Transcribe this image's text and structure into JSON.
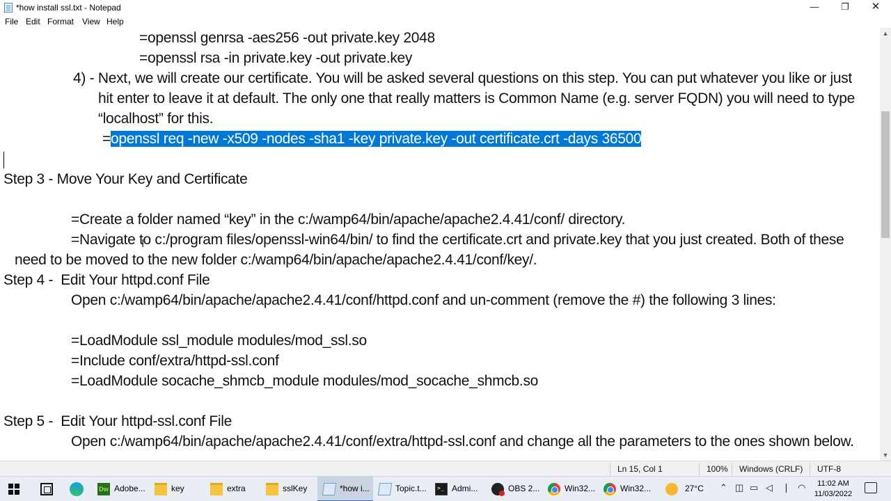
{
  "window": {
    "title": "*how install ssl.txt - Notepad",
    "minimize_glyph": "—",
    "maximize_glyph": "❐",
    "close_glyph": "✕"
  },
  "menu": {
    "items": [
      "File",
      "Edit",
      "Format",
      "View",
      "Help"
    ]
  },
  "editor": {
    "lines": [
      "=openssl genrsa -aes256 -out private.key 2048",
      "=openssl rsa -in private.key -out private.key",
      "4) - Next, we will create our certificate. You will be asked several questions on this step. You can put whatever you like or just",
      "hit enter to leave it at default. The only one that really matters is Common Name (e.g. server FQDN) you will need to type",
      "“localhost” for this.",
      "=",
      "openssl req -new -x509 -nodes -sha1 -key private.key -out certificate.crt -days 36500",
      "Step 3 - Move Your Key and Certificate",
      "=Create a folder named “key” in the c:/wamp64/bin/apache/apache2.4.41/conf/ directory.",
      "=Navigate to c:/program files/openssl-win64/bin/ to find the certificate.crt and private.key that you just created. Both of these",
      "need to be moved to the new folder c:/wamp64/bin/apache/apache2.4.41/conf/key/.",
      "Step 4 -  Edit Your httpd.conf File",
      "Open c:/wamp64/bin/apache/apache2.4.41/conf/httpd.conf and un-comment (remove the #) the following 3 lines:",
      "=LoadModule ssl_module modules/mod_ssl.so",
      "=Include conf/extra/httpd-ssl.conf",
      "=LoadModule socache_shmcb_module modules/mod_socache_shmcb.so",
      "Step 5 -  Edit Your httpd-ssl.conf File",
      "Open c:/wamp64/bin/apache/apache2.4.41/conf/extra/httpd-ssl.conf and change all the parameters to the ones shown below."
    ]
  },
  "scrollbar": {
    "up_glyph": "▲",
    "down_glyph": "▼"
  },
  "status": {
    "position": "Ln 15, Col 1",
    "zoom": "100%",
    "line_ending": "Windows (CRLF)",
    "encoding": "UTF-8"
  },
  "taskbar": {
    "items": [
      {
        "icon": "dreamweaver-icon",
        "label": "Adobe..."
      },
      {
        "icon": "folder-icon",
        "label": "key"
      },
      {
        "icon": "folder-icon",
        "label": "extra"
      },
      {
        "icon": "folder-icon",
        "label": "sslKey"
      },
      {
        "icon": "notepad-icon",
        "label": "*how i..."
      },
      {
        "icon": "notepad-icon",
        "label": "Topic.t..."
      },
      {
        "icon": "cmd-icon",
        "label": "Admi..."
      },
      {
        "icon": "obs-icon",
        "label": "OBS 2..."
      },
      {
        "icon": "chrome-icon",
        "label": "Win32..."
      },
      {
        "icon": "chrome-icon",
        "label": "Win32..."
      }
    ],
    "dw_text": "Dw",
    "weather": "27°C",
    "tray_icons": [
      "chevron-up-icon",
      "meet-now-icon",
      "battery-icon",
      "speaker-icon",
      "microphone-icon",
      "wifi-icon"
    ],
    "time": "11:02 AM",
    "date": "11/03/2022"
  },
  "colors": {
    "selection": "#0078d7",
    "taskbar": "#e9eef4"
  }
}
